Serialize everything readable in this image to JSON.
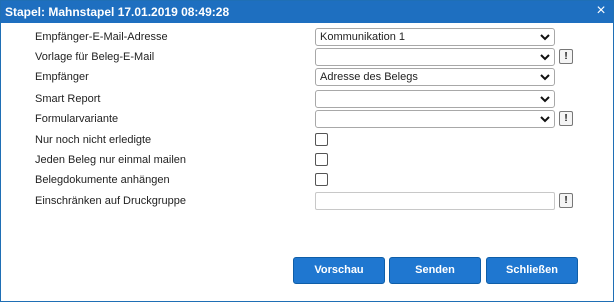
{
  "window": {
    "title": "Stapel: Mahnstapel 17.01.2019 08:49:28"
  },
  "form": {
    "rows": [
      {
        "label": "Empfänger-E-Mail-Adresse",
        "value": "Kommunikation 1"
      },
      {
        "label": "Vorlage für Beleg-E-Mail",
        "value": ""
      },
      {
        "label": "Empfänger",
        "value": "Adresse des Belegs"
      },
      {
        "label": "Smart Report",
        "value": ""
      },
      {
        "label": "Formularvariante",
        "value": ""
      },
      {
        "label": "Nur noch nicht erledigte",
        "checked": false
      },
      {
        "label": "Jeden Beleg nur einmal mailen",
        "checked": false
      },
      {
        "label": "Belegdokumente anhängen",
        "checked": false
      },
      {
        "label": "Einschränken auf Druckgruppe",
        "value": ""
      }
    ],
    "info_glyph": "!"
  },
  "buttons": {
    "preview": "Vorschau",
    "send": "Senden",
    "close": "Schließen"
  },
  "icons": {
    "close": "×",
    "chevron": "chevron-down-icon"
  },
  "colors": {
    "titlebar": "#1e6fc0",
    "button": "#1f77d0"
  }
}
